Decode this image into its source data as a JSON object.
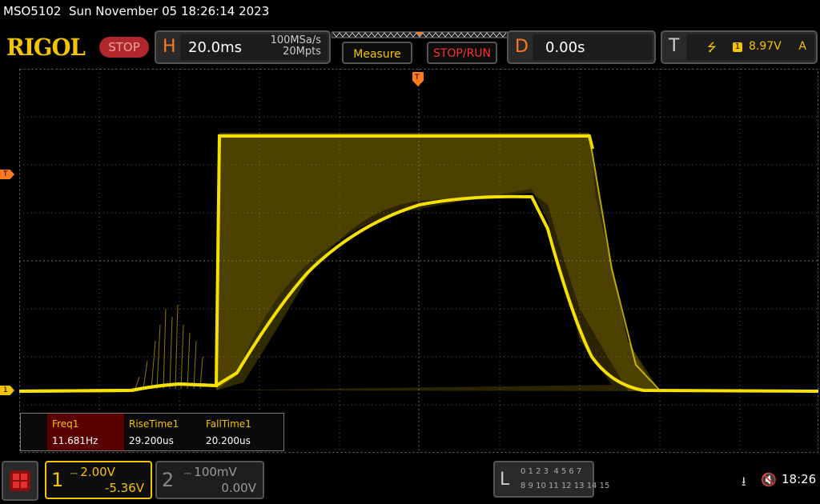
{
  "header": {
    "model_datetime": "MSO5102  Sun November 05 18:26:14 2023",
    "logo": "RIGOL",
    "run_state": "STOP"
  },
  "horizontal": {
    "letter": "H",
    "timebase": "20.0ms",
    "sample_rate": "100MSa/s",
    "memory_depth": "20Mpts"
  },
  "buttons": {
    "measure": "Measure",
    "stop_run": "STOP/RUN"
  },
  "delay": {
    "letter": "D",
    "value": "0.00s"
  },
  "trigger": {
    "letter": "T",
    "edge_symbol": "⭍",
    "source": "1",
    "level": "8.97V",
    "mode": "A"
  },
  "markers": {
    "trigger_time": "T",
    "trigger_level": "T",
    "ch1_ground": "1"
  },
  "measurements": [
    {
      "name": "Freq1",
      "value": "11.681Hz"
    },
    {
      "name": "RiseTime1",
      "value": "29.200us"
    },
    {
      "name": "FallTime1",
      "value": "20.200us"
    }
  ],
  "channels": {
    "ch1": {
      "number": "1",
      "scale": "2.00V",
      "offset": "-5.36V"
    },
    "ch2": {
      "number": "2",
      "scale": "100mV",
      "offset": "0.00V"
    }
  },
  "logic_analyzer": {
    "letter": "L",
    "row1": "0 1 2 3  4 5 6 7",
    "row2": "8 9 10 11 12 13 14 15"
  },
  "status": {
    "usb_icon": "⭳",
    "speaker_icon": "🔇",
    "clock": "18:26"
  },
  "colors": {
    "ch1": "#f5c400",
    "accent_orange": "#ff7a1f",
    "stop_red": "#b0282b"
  }
}
